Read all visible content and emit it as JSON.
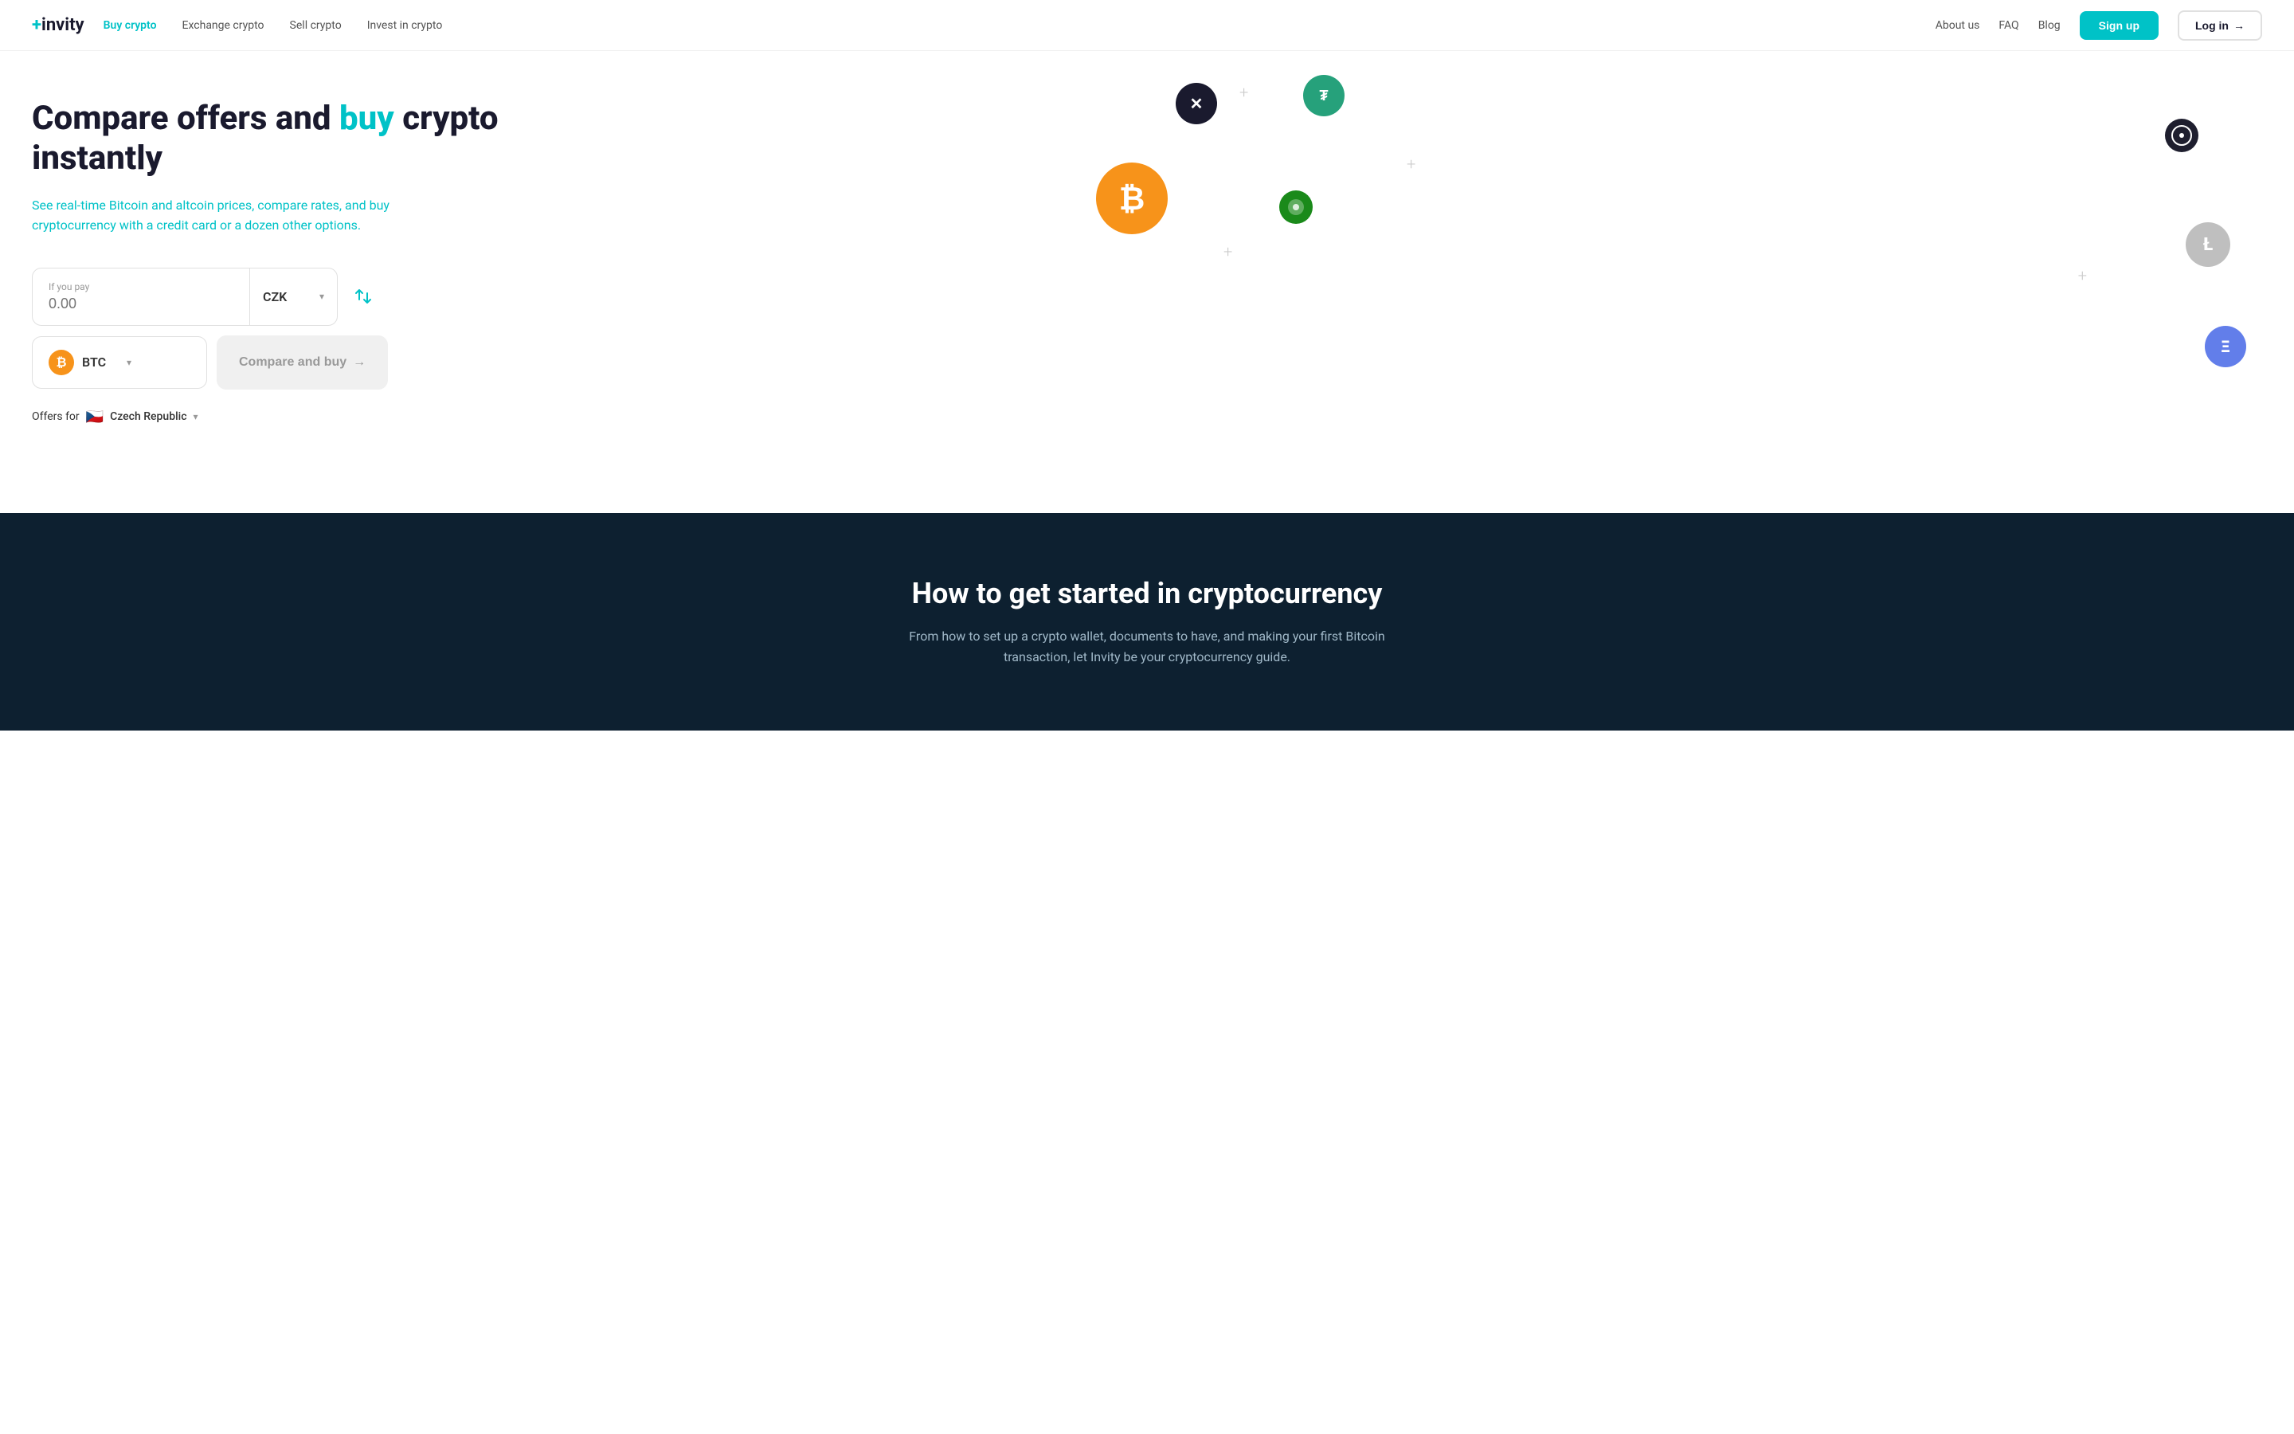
{
  "brand": {
    "prefix": "+",
    "name": "invity"
  },
  "nav": {
    "links": [
      {
        "id": "buy-crypto",
        "label": "Buy crypto",
        "active": true
      },
      {
        "id": "exchange-crypto",
        "label": "Exchange crypto",
        "active": false
      },
      {
        "id": "sell-crypto",
        "label": "Sell crypto",
        "active": false
      },
      {
        "id": "invest-crypto",
        "label": "Invest in crypto",
        "active": false
      }
    ],
    "right_links": [
      {
        "id": "about",
        "label": "About us"
      },
      {
        "id": "faq",
        "label": "FAQ"
      },
      {
        "id": "blog",
        "label": "Blog"
      }
    ],
    "signup_label": "Sign up",
    "login_label": "Log in"
  },
  "hero": {
    "title_start": "Compare offers and ",
    "title_highlight": "buy",
    "title_end": " crypto instantly",
    "subtitle": "See real-time Bitcoin and altcoin prices, compare rates, and buy cryptocurrency with a credit card or a dozen other options.",
    "form": {
      "input_label": "If you pay",
      "input_placeholder": "0.00",
      "currency": "CZK",
      "crypto": "BTC",
      "compare_label": "Compare and buy",
      "offers_label": "Offers for",
      "country": "Czech Republic"
    }
  },
  "dark_section": {
    "title": "How to get started in cryptocurrency",
    "subtitle": "From how to set up a crypto wallet, documents to have, and making your first Bitcoin transaction, let Invity be your cryptocurrency guide."
  },
  "crypto_icons": [
    {
      "id": "btc",
      "symbol": "₿",
      "color": "#f7931a"
    },
    {
      "id": "xem",
      "symbol": "✕",
      "color": "#1a1a2e"
    },
    {
      "id": "tether",
      "symbol": "₮",
      "color": "#26a17b"
    },
    {
      "id": "cosmos",
      "symbol": "⊛",
      "color": "#1e1e2e"
    },
    {
      "id": "btt",
      "symbol": "◑",
      "color": "#1a8a1a"
    },
    {
      "id": "ltc",
      "symbol": "Ł",
      "color": "#bfbfbf"
    },
    {
      "id": "eth",
      "symbol": "Ξ",
      "color": "#627eea"
    }
  ]
}
